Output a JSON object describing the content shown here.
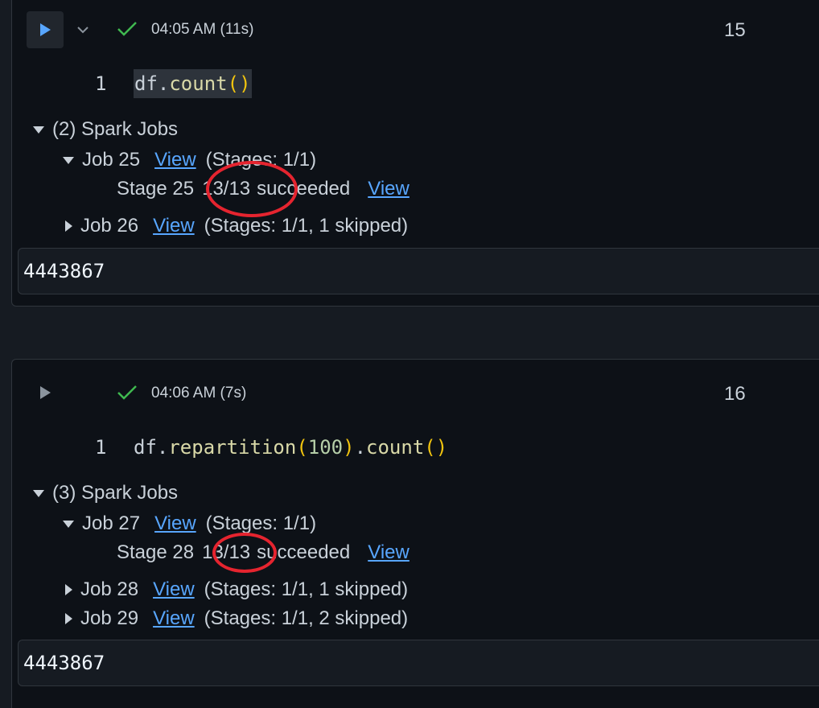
{
  "cells": [
    {
      "time": "04:05 AM (11s)",
      "exec_count": "15",
      "line_no": "1",
      "code": {
        "obj": "df",
        "dot1": ".",
        "fn1": "count",
        "open1": "(",
        "close1": ")"
      },
      "jobs_header": "(2) Spark Jobs",
      "jobs": [
        {
          "label": "Job 25",
          "link": "View",
          "stages": "(Stages: 1/1)"
        },
        {
          "label": "Job 26",
          "link": "View",
          "stages": "(Stages: 1/1, 1 skipped)"
        }
      ],
      "stage": {
        "label": "Stage 25",
        "progress": "13/13",
        "status": "succeeded",
        "link": "View"
      },
      "output": "4443867"
    },
    {
      "time": "04:06 AM (7s)",
      "exec_count": "16",
      "line_no": "1",
      "code": {
        "obj": "df",
        "dot1": ".",
        "fn1": "repartition",
        "open1": "(",
        "arg": "100",
        "close1": ")",
        "dot2": ".",
        "fn2": "count",
        "open2": "(",
        "close2": ")"
      },
      "jobs_header": "(3) Spark Jobs",
      "jobs": [
        {
          "label": "Job 27",
          "link": "View",
          "stages": "(Stages: 1/1)"
        },
        {
          "label": "Job 28",
          "link": "View",
          "stages": "(Stages: 1/1, 1 skipped)"
        },
        {
          "label": "Job 29",
          "link": "View",
          "stages": "(Stages: 1/1, 2 skipped)"
        }
      ],
      "stage": {
        "label": "Stage 28",
        "progress": "13/13",
        "status": "succeeded",
        "link": "View"
      },
      "output": "4443867"
    }
  ],
  "colors": {
    "accent_run": "#58a6ff",
    "success": "#3fb950",
    "link": "#58a6ff",
    "annotation": "#e5242f"
  },
  "icons": {
    "run": "play-icon",
    "collapse": "chevron-down-icon",
    "status": "check-icon",
    "tree_open": "triangle-down-icon",
    "tree_closed": "triangle-right-icon"
  }
}
